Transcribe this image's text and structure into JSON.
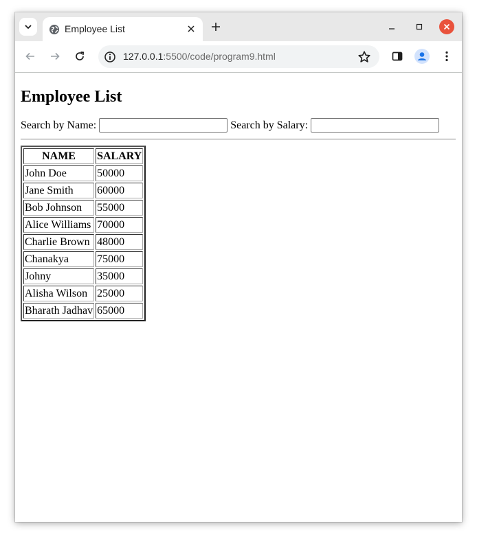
{
  "browser": {
    "tab": {
      "title": "Employee List"
    },
    "address": {
      "host": "127.0.0.1",
      "path": ":5500/code/program9.html"
    }
  },
  "page": {
    "title": "Employee List",
    "search_name_label": "Search by Name:",
    "search_name_value": "",
    "search_salary_label": "Search by Salary:",
    "search_salary_value": "",
    "table": {
      "headers": [
        "NAME",
        "SALARY"
      ],
      "rows": [
        [
          "John Doe",
          "50000"
        ],
        [
          "Jane Smith",
          "60000"
        ],
        [
          "Bob Johnson",
          "55000"
        ],
        [
          "Alice Williams",
          "70000"
        ],
        [
          "Charlie Brown",
          "48000"
        ],
        [
          "Chanakya",
          "75000"
        ],
        [
          "Johny",
          "35000"
        ],
        [
          "Alisha Wilson",
          "25000"
        ],
        [
          "Bharath Jadhav",
          "65000"
        ]
      ]
    }
  },
  "icons": {
    "tab_search": "chevron-down-icon",
    "favicon": "globe-icon",
    "tab_close": "close-icon",
    "new_tab": "plus-icon",
    "minimize": "minimize-icon",
    "maximize": "maximize-icon",
    "close_window": "close-icon",
    "back": "arrow-left-icon",
    "forward": "arrow-right-icon",
    "reload": "reload-icon",
    "site_info": "info-icon",
    "bookmark": "star-icon",
    "side_panel": "side-panel-icon",
    "profile": "profile-icon",
    "menu": "kebab-menu-icon"
  },
  "colors": {
    "window_close": "#e9523c",
    "profile_accent": "#1a73e8"
  }
}
